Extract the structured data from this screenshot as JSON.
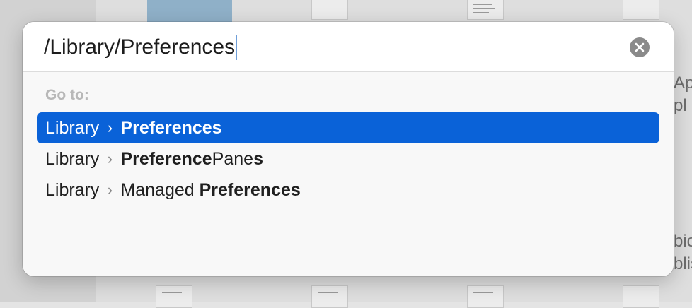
{
  "background": {
    "right_text": [
      "Ap",
      "pl",
      "bic",
      "blis"
    ]
  },
  "dialog": {
    "path_value": "/Library/Preferences",
    "clear_icon": "xmark-circle-icon",
    "goto_label": "Go to:",
    "suggestions": [
      {
        "parent": "Library",
        "separator": "›",
        "parts": [
          {
            "text": "Preferences",
            "bold": true
          }
        ],
        "selected": true
      },
      {
        "parent": "Library",
        "separator": "›",
        "parts": [
          {
            "text": "Preference",
            "bold": true
          },
          {
            "text": "Pane",
            "bold": false
          },
          {
            "text": "s",
            "bold": true
          }
        ],
        "selected": false
      },
      {
        "parent": "Library",
        "separator": "›",
        "parts": [
          {
            "text": "Managed ",
            "bold": false
          },
          {
            "text": "Preferences",
            "bold": true
          }
        ],
        "selected": false
      }
    ]
  },
  "colors": {
    "selection": "#0a62d8",
    "caret": "#6f9fd9"
  }
}
